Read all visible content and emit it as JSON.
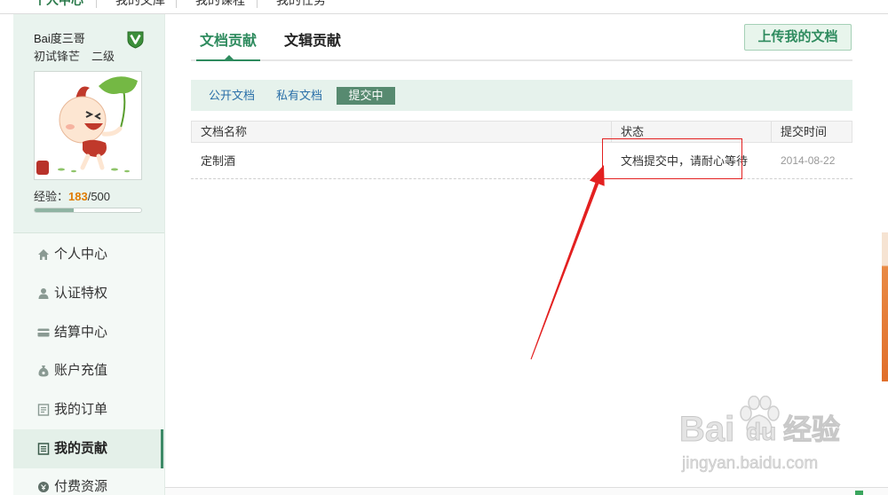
{
  "top_nav": {
    "items": [
      "个人中心",
      "我的文库",
      "我的课程",
      "我的任务"
    ]
  },
  "profile": {
    "name": "Bai度三哥",
    "rank_title": "初试锋芒",
    "level": "二级",
    "exp_label": "经验：",
    "exp_current": "183",
    "exp_total": "/500",
    "exp_progress": 0.366
  },
  "sidebar": {
    "items": [
      {
        "label": "个人中心",
        "icon": "home-icon"
      },
      {
        "label": "认证特权",
        "icon": "person-icon"
      },
      {
        "label": "结算中心",
        "icon": "card-icon"
      },
      {
        "label": "账户充值",
        "icon": "money-bag-icon"
      },
      {
        "label": "我的订单",
        "icon": "receipt-icon"
      },
      {
        "label": "我的贡献",
        "icon": "document-icon",
        "active": true
      },
      {
        "label": "付费资源",
        "icon": "coin-icon"
      }
    ]
  },
  "main": {
    "tabs": [
      {
        "label": "文档贡献",
        "active": true
      },
      {
        "label": "文辑贡献",
        "active": false
      }
    ],
    "upload_button": "上传我的文档",
    "subtabs": [
      {
        "label": "公开文档"
      },
      {
        "label": "私有文档"
      },
      {
        "label": "提交中",
        "active": true
      }
    ],
    "table": {
      "columns": [
        "文档名称",
        "状态",
        "提交时间"
      ],
      "rows": [
        {
          "name": "定制酒",
          "status": "文档提交中，请耐心等待",
          "submitted": "2014-08-22"
        }
      ]
    }
  },
  "watermark": {
    "brand_left": "Bai",
    "brand_right": "du",
    "product": "经验",
    "url": "jingyan.baidu.com"
  },
  "colors": {
    "accent_green": "#2e8b5e",
    "exp_highlight": "#e07b00",
    "annotation_red": "#e32020",
    "subtab_link": "#2a6fa8",
    "active_subtab_bg": "#578a70"
  }
}
